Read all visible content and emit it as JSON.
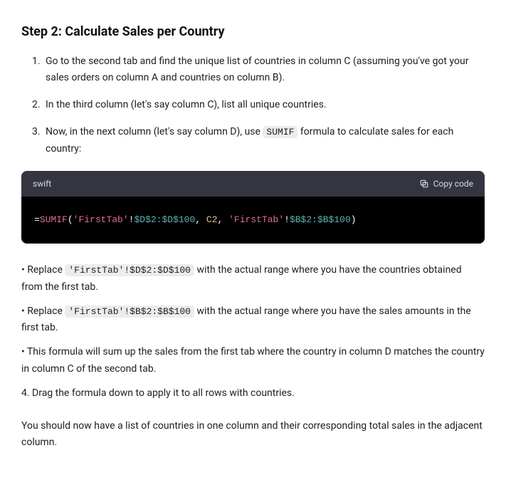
{
  "heading": "Step 2: Calculate Sales per Country",
  "steps": [
    "Go to the second tab and find the unique list of countries in column C (assuming you've got your sales orders on column A and countries on column B).",
    "In the third column (let's say column C), list all unique countries.",
    "Now, in the next column (let's say column D), use "
  ],
  "step3_code": "SUMIF",
  "step3_suffix": " formula to calculate sales for each country:",
  "codeblock": {
    "language": "swift",
    "copy_label": "Copy code",
    "tokens": {
      "t0": "=",
      "t1": "SUMIF",
      "t2": "(",
      "t3": "'FirstTab'",
      "t4": "!",
      "t5": "$D$2:$D$100",
      "t6": ", ",
      "t7": "C2",
      "t8": ", ",
      "t9": "'FirstTab'",
      "t10": "!",
      "t11": "$B$2:$B$100",
      "t12": ")"
    }
  },
  "notes": {
    "n1_prefix": "Replace ",
    "n1_code": "'FirstTab'!$D$2:$D$100",
    "n1_suffix": " with the actual range where you have the countries obtained from the first tab.",
    "n2_prefix": "Replace ",
    "n2_code": "'FirstTab'!$B$2:$B$100",
    "n2_suffix": " with the actual range where you have the sales amounts in the first tab.",
    "n3": "This formula will sum up the sales from the first tab where the country in column D matches the country in column C of the second tab.",
    "n4": "4. Drag the formula down to apply it to all rows with countries."
  },
  "closing": "You should now have a list of countries in one column and their corresponding total sales in the adjacent column."
}
